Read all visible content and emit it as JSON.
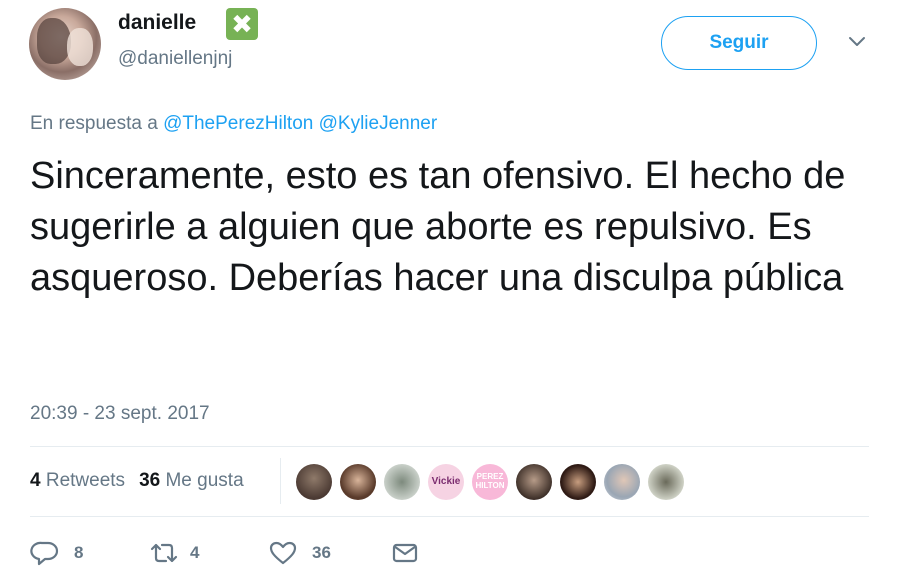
{
  "author": {
    "display_name": "danielle",
    "handle": "@daniellenjnj",
    "verified_badge": "✖"
  },
  "follow_button": {
    "label": "Seguir"
  },
  "reply": {
    "prefix": "En respuesta a",
    "mentions": [
      "@ThePerezHilton",
      "@KylieJenner"
    ]
  },
  "tweet": {
    "text": "Sinceramente, esto es tan ofensivo. El hecho de sugerirle a alguien que aborte es repulsivo. Es asqueroso. Deberías hacer una disculpa pública",
    "timestamp": "20:39 - 23 sept. 2017"
  },
  "stats": {
    "retweets_count": "4",
    "retweets_label": "Retweets",
    "likes_count": "36",
    "likes_label": "Me gusta"
  },
  "liker_avatars": [
    {
      "label": ""
    },
    {
      "label": ""
    },
    {
      "label": ""
    },
    {
      "label": "Vickie"
    },
    {
      "label": "PEREZ HILTON"
    },
    {
      "label": ""
    },
    {
      "label": ""
    },
    {
      "label": ""
    },
    {
      "label": ""
    }
  ],
  "actions": {
    "reply_count": "8",
    "retweet_count": "4",
    "like_count": "36"
  },
  "colors": {
    "accent": "#1da1f2",
    "muted": "#657786",
    "text": "#14171a",
    "badge": "#77b255"
  }
}
